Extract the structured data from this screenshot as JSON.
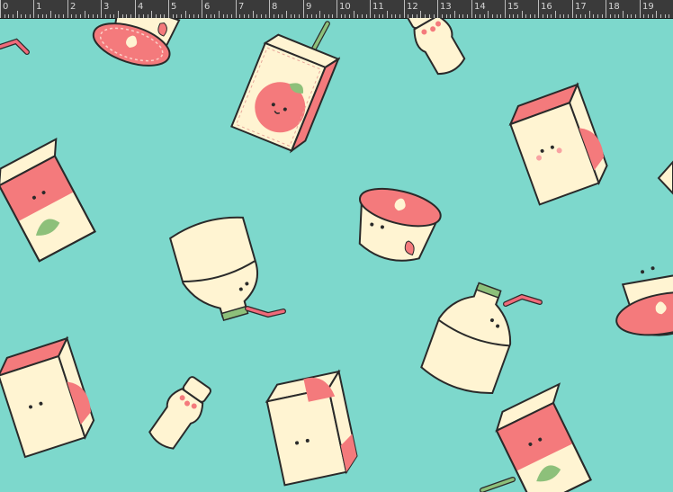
{
  "ruler": {
    "labels": [
      "0",
      "1",
      "2",
      "3",
      "4",
      "5",
      "6",
      "7",
      "8",
      "9",
      "10",
      "11",
      "12",
      "13",
      "14",
      "15",
      "16",
      "17",
      "18",
      "19"
    ]
  },
  "colors": {
    "canvas": "#7dd8cc",
    "cream": "#fff4d2",
    "pink": "#f47a7c",
    "leaf": "#8dc07a",
    "outline": "#2a2a2a",
    "straw": "#f06a7a"
  },
  "stickers": [
    {
      "kind": "juice-box"
    },
    {
      "kind": "juice-box"
    },
    {
      "kind": "juice-box"
    },
    {
      "kind": "juice-box"
    },
    {
      "kind": "juice-box"
    },
    {
      "kind": "juice-box"
    },
    {
      "kind": "yogurt-cup"
    },
    {
      "kind": "yogurt-cup"
    },
    {
      "kind": "yogurt-cup"
    },
    {
      "kind": "drink-bottle"
    },
    {
      "kind": "drink-bottle"
    },
    {
      "kind": "yakult-bottle"
    },
    {
      "kind": "yakult-bottle"
    }
  ]
}
